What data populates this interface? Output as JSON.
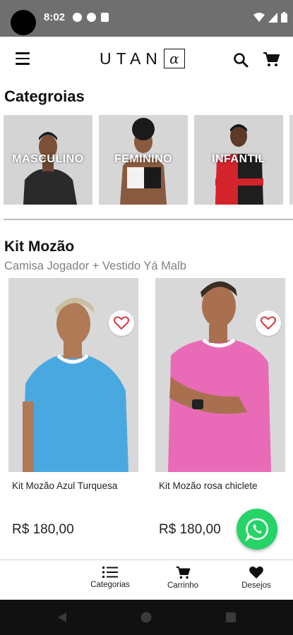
{
  "status_bar": {
    "time": "8:02"
  },
  "header": {
    "logo_text": "UTAN",
    "logo_mark": "α",
    "menu_icon": "hamburger-menu-icon",
    "search_icon": "search-icon",
    "cart_icon": "cart-icon"
  },
  "categories": {
    "title": "Categroias",
    "items": [
      {
        "label": "MASCULINO"
      },
      {
        "label": "FEMININO"
      },
      {
        "label": "INFANTIL"
      }
    ]
  },
  "kit": {
    "title": "Kit Mozão",
    "subtitle": "Camisa Jogador + Vestido Yá Malb",
    "products": [
      {
        "name": "Kit Mozão Azul Turquesa",
        "price": "R$  180,00",
        "shirt_color": "#4aa8e0"
      },
      {
        "name": "Kit Mozão rosa chiclete",
        "price": "R$  180,00",
        "shirt_color": "#e96bb8"
      }
    ]
  },
  "bottom_nav": {
    "items": [
      {
        "label": "Categorias",
        "icon": "list-icon"
      },
      {
        "label": "Carrinho",
        "icon": "cart-icon"
      },
      {
        "label": "Desejos",
        "icon": "heart-icon"
      }
    ]
  },
  "colors": {
    "status_bar": "#6f6f6f",
    "whatsapp": "#25d366",
    "heart": "#d9363e",
    "subtitle_gray": "#808080"
  }
}
